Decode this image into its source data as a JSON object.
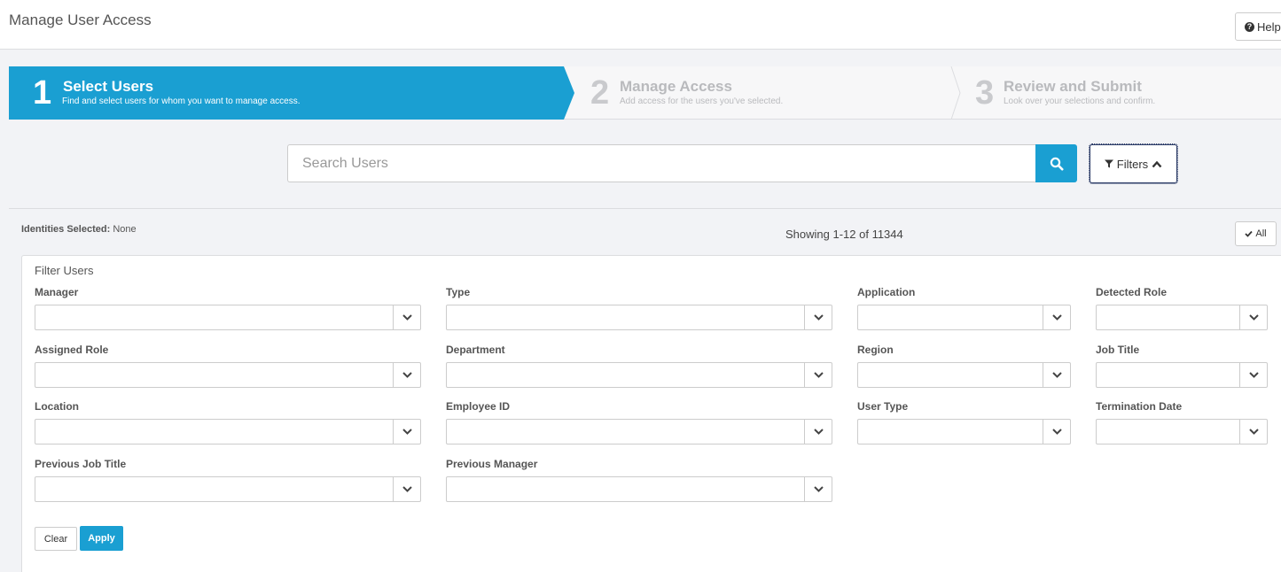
{
  "header": {
    "title": "Manage User Access",
    "help_label": "Help"
  },
  "wizard": {
    "steps": [
      {
        "number": "1",
        "title": "Select Users",
        "description": "Find and select users for whom you want to manage access."
      },
      {
        "number": "2",
        "title": "Manage Access",
        "description": "Add access for the users you've selected."
      },
      {
        "number": "3",
        "title": "Review and Submit",
        "description": "Look over your selections and confirm."
      }
    ],
    "active_step": 1
  },
  "search": {
    "placeholder": "Search Users",
    "value": "",
    "filters_label": "Filters"
  },
  "results": {
    "identities_label": "Identities Selected:",
    "identities_value": "None",
    "showing": "Showing 1-12 of 11344",
    "all_label": "All"
  },
  "filter_panel": {
    "title": "Filter Users",
    "fields": {
      "manager": "Manager",
      "type": "Type",
      "application": "Application",
      "detected_role": "Detected Role",
      "assigned_role": "Assigned Role",
      "department": "Department",
      "region": "Region",
      "job_title": "Job Title",
      "location": "Location",
      "employee_id": "Employee ID",
      "user_type": "User Type",
      "termination_date": "Termination Date",
      "previous_job_title": "Previous Job Title",
      "previous_manager": "Previous Manager"
    },
    "clear_label": "Clear",
    "apply_label": "Apply"
  },
  "colors": {
    "accent": "#1a9fd2",
    "background": "#f2f3f6"
  }
}
